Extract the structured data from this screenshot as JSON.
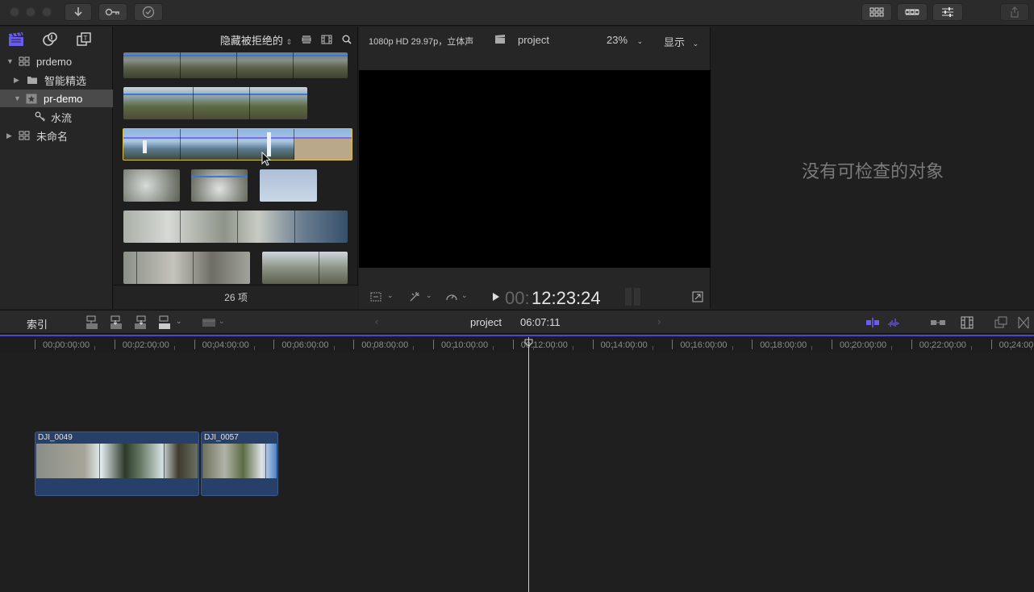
{
  "toolbar": {
    "import_icon": "download-icon",
    "keywords_icon": "key-icon",
    "background_tasks_icon": "checkmark-circle-icon",
    "layout_icons": [
      "grid-icon",
      "filmstrip-icon",
      "sliders-icon"
    ],
    "share_icon": "share-icon"
  },
  "libraries": {
    "header_icons": [
      "libraries-clapper-icon",
      "photos-audio-icon",
      "titles-generators-icon"
    ],
    "items": [
      {
        "label": "prdemo",
        "level": 0,
        "expanded": true,
        "icon": "library-icon",
        "selected": false
      },
      {
        "label": "智能精选",
        "level": 1,
        "expanded": false,
        "icon": "folder-icon",
        "selected": false
      },
      {
        "label": "pr-demo",
        "level": 1,
        "expanded": true,
        "icon": "event-star-icon",
        "selected": true
      },
      {
        "label": "水流",
        "level": 2,
        "expanded": false,
        "icon": "keyword-icon",
        "selected": false
      },
      {
        "label": "未命名",
        "level": 0,
        "expanded": false,
        "icon": "library-icon",
        "selected": false
      }
    ]
  },
  "browser": {
    "filter_label": "隐藏被拒绝的",
    "item_count": "26 项"
  },
  "viewer": {
    "format": "1080p HD 29.97p，立体声",
    "project_name": "project",
    "zoom": "23%",
    "display_label": "显示",
    "timecode_dim": "00:",
    "timecode": "12:23:24"
  },
  "inspector": {
    "empty_message": "没有可检查的对象"
  },
  "timeline": {
    "index_label": "索引",
    "project_name": "project",
    "duration": "06:07:11",
    "ruler_labels": [
      "00:00:00:00",
      "00:02:00:00",
      "00:04:00:00",
      "00:06:00:00",
      "00:08:00:00",
      "00:10:00:00",
      "00:12:00:00",
      "00:14:00:00",
      "00:16:00:00",
      "00:18:00:00",
      "00:20:00:00",
      "00:22:00:00",
      "00:24:00"
    ],
    "clips": [
      {
        "name": "DJI_0049"
      },
      {
        "name": "DJI_0057"
      }
    ]
  },
  "colors": {
    "accent": "#4c48c8",
    "clip_blue": "#27406a",
    "selection_yellow": "#e0c040"
  }
}
